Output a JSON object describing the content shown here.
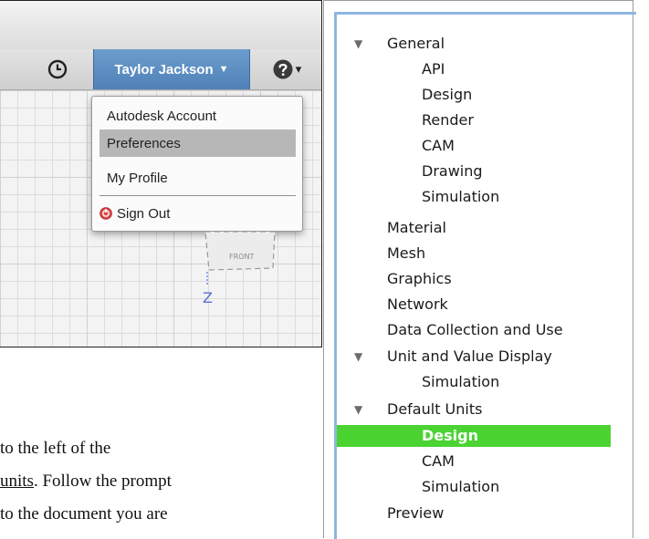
{
  "toolbar": {
    "user_name": "Taylor Jackson",
    "user_caret": "▼",
    "help_caret": "▾"
  },
  "user_menu": {
    "items": [
      "Autodesk Account",
      "Preferences",
      "My Profile",
      "Sign Out"
    ],
    "highlighted": "Preferences"
  },
  "viewport": {
    "viewcube_face": "FRONT",
    "axis_label": "Z"
  },
  "body_text": {
    "line1": "to the left of the",
    "line2_pre": "",
    "line2_link": "units",
    "line2_post": ". Follow the prompt",
    "line3": "to the document you are"
  },
  "preferences_tree": {
    "selected": "Design",
    "selection_color": "#4bd332",
    "items": [
      {
        "label": "General",
        "expanded": true
      },
      {
        "label": "API"
      },
      {
        "label": "Design"
      },
      {
        "label": "Render"
      },
      {
        "label": "CAM"
      },
      {
        "label": "Drawing"
      },
      {
        "label": "Simulation"
      },
      {
        "label": "Material"
      },
      {
        "label": "Mesh"
      },
      {
        "label": "Graphics"
      },
      {
        "label": "Network"
      },
      {
        "label": "Data Collection and Use"
      },
      {
        "label": "Unit and Value Display",
        "expanded": true
      },
      {
        "label": "Simulation"
      },
      {
        "label": "Default Units",
        "expanded": true
      },
      {
        "label": "Design"
      },
      {
        "label": "CAM"
      },
      {
        "label": "Simulation"
      },
      {
        "label": "Preview"
      }
    ]
  }
}
